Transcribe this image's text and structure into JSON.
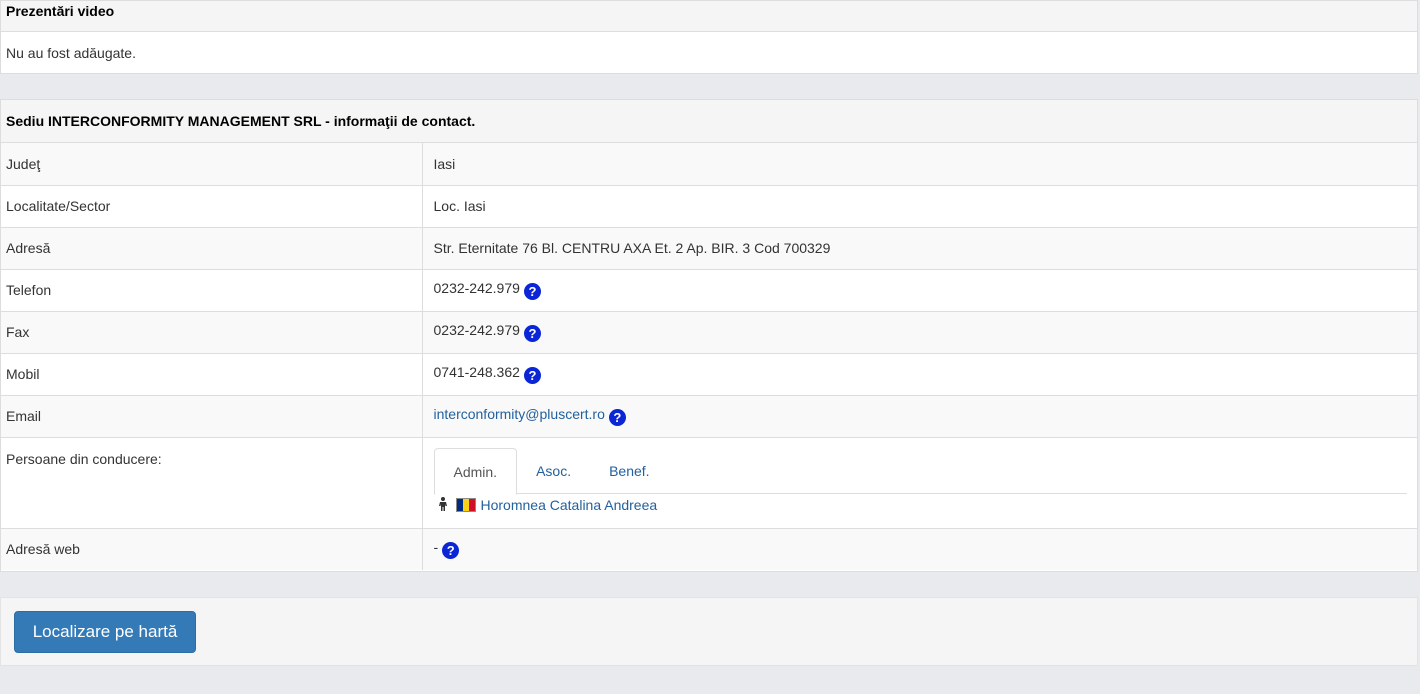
{
  "video_panel": {
    "title": "Prezentări video",
    "body": "Nu au fost adăugate."
  },
  "contact_panel": {
    "title": "Sediu INTERCONFORMITY MANAGEMENT SRL - informaţii de contact.",
    "rows": {
      "judet": {
        "label": "Judeţ",
        "value": "Iasi"
      },
      "localitate": {
        "label": "Localitate/Sector",
        "value": "Loc. Iasi"
      },
      "adresa": {
        "label": "Adresă",
        "value": "Str. Eternitate 76 Bl. CENTRU AXA Et. 2 Ap. BIR. 3 Cod 700329"
      },
      "telefon": {
        "label": "Telefon",
        "value": "0232-242.979"
      },
      "fax": {
        "label": "Fax",
        "value": "0232-242.979"
      },
      "mobil": {
        "label": "Mobil",
        "value": "0741-248.362"
      },
      "email": {
        "label": "Email",
        "value": "interconformity@pluscert.ro"
      },
      "persoane": {
        "label": "Persoane din conducere:",
        "tabs": [
          "Admin.",
          "Asoc.",
          "Benef."
        ],
        "active_tab": "Admin.",
        "person_name": "Horomnea Catalina Andreea",
        "person_icon": "person-icon",
        "flag": "romania-flag"
      },
      "adresa_web": {
        "label": "Adresă web",
        "value": "-"
      }
    },
    "help_icon_glyph": "?"
  },
  "map_panel": {
    "button_label": "Localizare pe hartă"
  },
  "colors": {
    "link": "#23619e",
    "help_icon": "#0a26d6",
    "button": "#337ab7",
    "flag_blue": "#002b7f",
    "flag_yellow": "#fcd116",
    "flag_red": "#ce1126"
  }
}
